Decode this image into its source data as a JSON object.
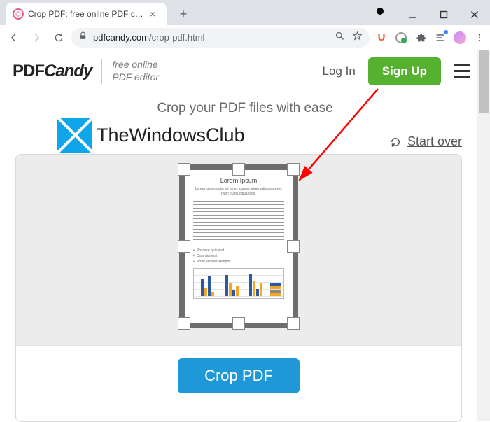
{
  "browser": {
    "tab_title": "Crop PDF: free online PDF cropp",
    "url_host": "pdfcandy.com",
    "url_path": "/crop-pdf.html",
    "new_tab_glyph": "+",
    "tab_close_glyph": "×"
  },
  "site": {
    "logo_part1": "PDF",
    "logo_part2": "Candy",
    "tagline_l1": "free online",
    "tagline_l2": "PDF editor",
    "login": "Log In",
    "signup": "Sign Up",
    "subheadline": "Crop your PDF files with ease",
    "start_over": "Start over",
    "crop_button": "Crop PDF"
  },
  "watermark": {
    "text": "TheWindowsClub"
  },
  "pdf_preview": {
    "title": "Lorem Ipsum",
    "subtitle": "Lorem ipsum dolor sit amet, consectetuer adipiscing elit. Nam eu faucibus odio.",
    "bullets": [
      "Posuere quis erat",
      "Cras nisi erat",
      "Proin semper semper"
    ]
  }
}
